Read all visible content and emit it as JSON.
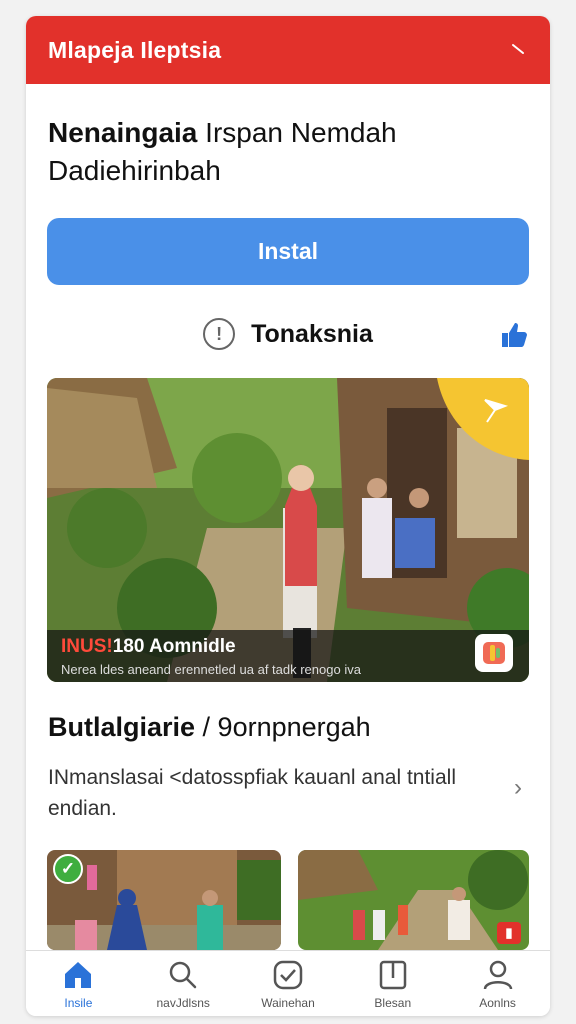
{
  "header": {
    "title": "Mlapeja Ileptsia"
  },
  "headline": {
    "bold": "Nenaingaia",
    "rest": " Irspan Nemdah Dadiehirinbah"
  },
  "install_button": {
    "label": "Instal"
  },
  "status": {
    "label": "Tonaksnia"
  },
  "hero": {
    "caption_title_red": "INUS!",
    "caption_title_white": "180 Aomnidle",
    "caption_sub": "Nerea ldes aneand erennetled ua af tadk renogo iva"
  },
  "section": {
    "title_bold": "Butlalgiarie",
    "title_rest": " / 9ornpnergah",
    "description": "INmanslasai <datosspfiak kauanl anal tntiall endian."
  },
  "nav": {
    "items": [
      {
        "label": "Insile",
        "icon": "home-icon"
      },
      {
        "label": "navJdlsns",
        "icon": "search-icon"
      },
      {
        "label": "Wainehan",
        "icon": "check-icon"
      },
      {
        "label": "Blesan",
        "icon": "book-icon"
      },
      {
        "label": "Aonlns",
        "icon": "profile-icon"
      }
    ]
  },
  "colors": {
    "header": "#e2312b",
    "install": "#4a90e8",
    "active_nav": "#2a72d8"
  }
}
